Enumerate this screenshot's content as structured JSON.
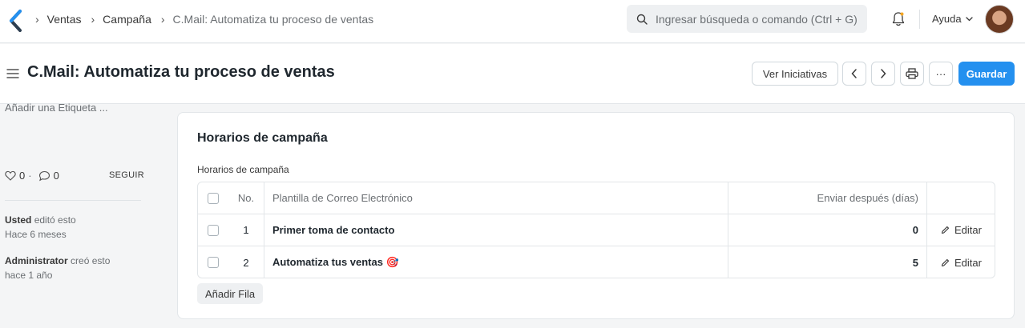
{
  "navbar": {
    "breadcrumbs": [
      "Ventas",
      "Campaña",
      "C.Mail: Automatiza tu proceso de ventas"
    ],
    "search_placeholder": "Ingresar búsqueda o comando (Ctrl + G)",
    "help_label": "Ayuda",
    "icons": [
      "logo-icon",
      "search-icon",
      "bell-icon",
      "chevron-down-icon",
      "avatar"
    ]
  },
  "page": {
    "title": "C.Mail: Automatiza tu proceso de ventas",
    "buttons": {
      "iniciativas": "Ver Iniciativas",
      "save": "Guardar",
      "more": "···"
    }
  },
  "sidebar": {
    "add_tag": "Añadir una Etiqueta ...",
    "likes": "0",
    "comments": "0",
    "separator": "·",
    "follow": "SEGUIR",
    "activity": [
      {
        "actor": "Usted",
        "action": "editó esto",
        "time": "Hace 6 meses"
      },
      {
        "actor": "Administrator",
        "action": "creó esto",
        "time": "hace 1 año"
      }
    ]
  },
  "schedule": {
    "section_title": "Horarios de campaña",
    "table_label": "Horarios de campaña",
    "columns": {
      "no": "No.",
      "template": "Plantilla de Correo Electrónico",
      "days": "Enviar después (días)"
    },
    "rows": [
      {
        "no": "1",
        "template": "Primer toma de contacto",
        "days": "0",
        "edit": "Editar"
      },
      {
        "no": "2",
        "template": "Automatiza tus ventas 🎯",
        "days": "5",
        "edit": "Editar"
      }
    ],
    "add_row": "Añadir Fila"
  },
  "colors": {
    "primary": "#2490ef",
    "background": "#f4f5f6",
    "logo": "#2d3e50"
  }
}
